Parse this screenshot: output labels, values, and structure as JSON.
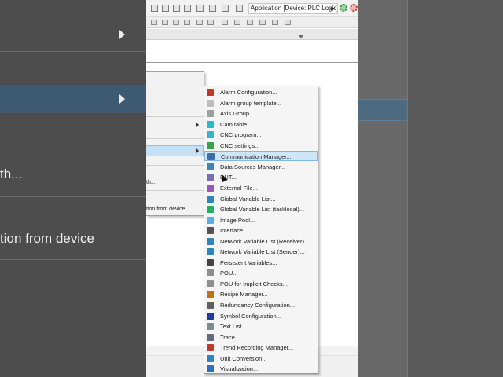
{
  "toolbar": {
    "application_selector": "Application [Device: PLC Logic]"
  },
  "background_menu": {
    "item_1": "th...",
    "item_2": "tion from device"
  },
  "parent_menu": {
    "item_1": "th...",
    "item_2": "tion from device"
  },
  "submenu": {
    "highlighted_index": 6,
    "items": [
      {
        "label": "Alarm Configuration...",
        "icon": "alarm-config-icon",
        "color": "#c0392b"
      },
      {
        "label": "Alarm group template...",
        "icon": "warning-triangle-icon",
        "color": "#bdbdbd"
      },
      {
        "label": "Axis Group...",
        "icon": "axis-group-icon",
        "color": "#9e9e9e"
      },
      {
        "label": "Cam table...",
        "icon": "cam-table-icon",
        "color": "#2fb8c9"
      },
      {
        "label": "CNC program...",
        "icon": "cnc-program-icon",
        "color": "#2fb8c9"
      },
      {
        "label": "CNC settings...",
        "icon": "cnc-settings-icon",
        "color": "#3aa34a"
      },
      {
        "label": "Communication Manager...",
        "icon": "communication-manager-icon",
        "color": "#3b6ea8"
      },
      {
        "label": "Data Sources Manager...",
        "icon": "data-sources-icon",
        "color": "#4a7fb5"
      },
      {
        "label": "DUT...",
        "icon": "dut-icon",
        "color": "#7b6fb0"
      },
      {
        "label": "External File...",
        "icon": "external-file-icon",
        "color": "#9b59b6"
      },
      {
        "label": "Global Variable List...",
        "icon": "globe-icon",
        "color": "#2e86c1"
      },
      {
        "label": "Global Variable List (tasklocal)...",
        "icon": "globe-tasklocal-icon",
        "color": "#27ae60"
      },
      {
        "label": "Image Pool...",
        "icon": "image-pool-icon",
        "color": "#5dade2"
      },
      {
        "label": "Interface...",
        "icon": "interface-icon",
        "color": "#555555"
      },
      {
        "label": "Network Variable List (Receiver)...",
        "icon": "network-receiver-icon",
        "color": "#2e86c1"
      },
      {
        "label": "Network Variable List (Sender)...",
        "icon": "network-sender-icon",
        "color": "#2e86c1"
      },
      {
        "label": "Persistent Variables...",
        "icon": "persistent-variables-icon",
        "color": "#444444"
      },
      {
        "label": "POU...",
        "icon": "pou-icon",
        "color": "#8e8e8e"
      },
      {
        "label": "POU for Implicit Checks...",
        "icon": "pou-checks-icon",
        "color": "#8e8e8e"
      },
      {
        "label": "Recipe Manager...",
        "icon": "recipe-manager-icon",
        "color": "#b9770e"
      },
      {
        "label": "Redundancy Configuration...",
        "icon": "redundancy-icon",
        "color": "#616161"
      },
      {
        "label": "Symbol Configuration...",
        "icon": "symbol-config-icon",
        "color": "#1f3d99"
      },
      {
        "label": "Text List...",
        "icon": "text-list-icon",
        "color": "#7f8c8d"
      },
      {
        "label": "Trace...",
        "icon": "trace-icon",
        "color": "#5d6d7e"
      },
      {
        "label": "Trend Recording Manager...",
        "icon": "trend-recording-icon",
        "color": "#c0392b"
      },
      {
        "label": "Unit Conversion...",
        "icon": "unit-conversion-icon",
        "color": "#2e86c1"
      },
      {
        "label": "Visualization...",
        "icon": "visualization-icon",
        "color": "#2f6fbf"
      }
    ]
  }
}
